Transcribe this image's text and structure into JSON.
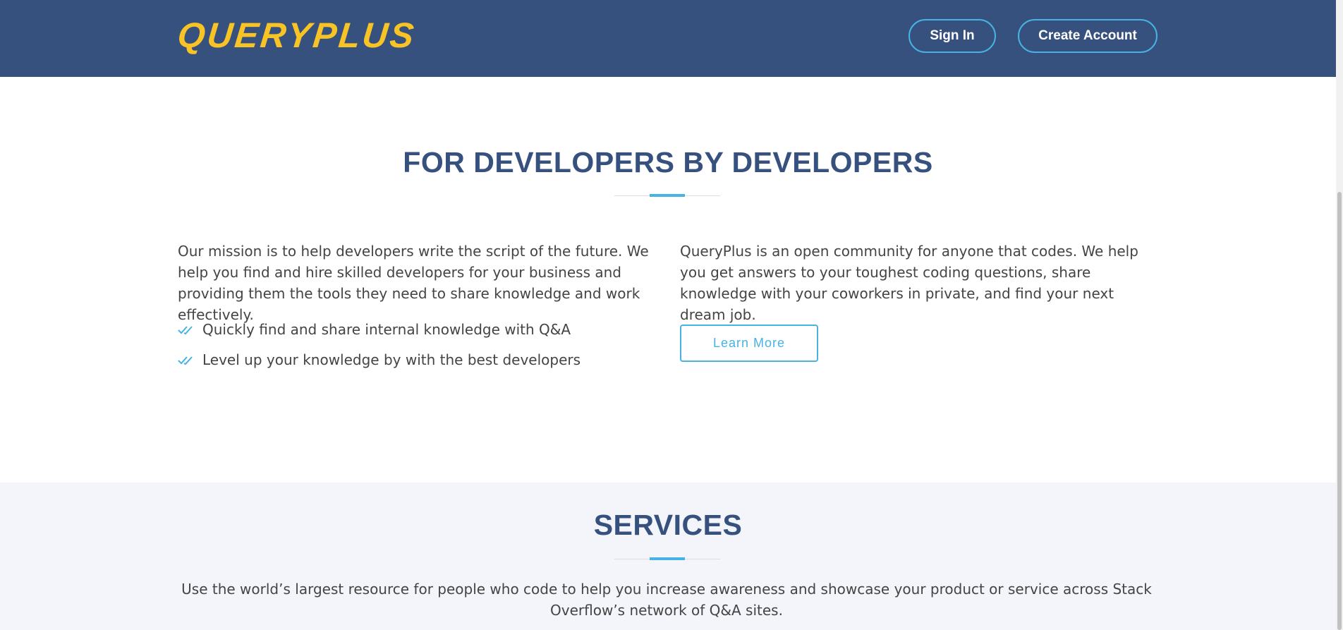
{
  "header": {
    "logo_text": "QUERYPLUS",
    "sign_in_label": "Sign In",
    "create_account_label": "Create Account"
  },
  "about": {
    "title": "FOR DEVELOPERS BY DEVELOPERS",
    "left_paragraph": "Our mission is to help developers write the script of the future. We help you find and hire skilled developers for your business and providing them the tools they need to share knowledge and work effectively.",
    "checklist": [
      {
        "icon": "double-check-icon",
        "text": "Quickly find and share internal knowledge with Q&A"
      },
      {
        "icon": "double-check-icon",
        "text": "Level up your knowledge by with the best developers"
      }
    ],
    "right_paragraph": "QueryPlus is an open community for anyone that codes. We help you get answers to your toughest coding questions, share knowledge with your coworkers in private, and find your next dream job.",
    "learn_more_label": "Learn More"
  },
  "services": {
    "title": "SERVICES",
    "description": "Use the world’s largest resource for people who code to help you increase awareness and showcase your product or service across Stack Overflow’s network of Q&A sites."
  },
  "colors": {
    "header_bg": "#37517e",
    "logo": "#f7c325",
    "accent": "#47b2e4",
    "heading": "#37517e",
    "body_text": "#444444",
    "services_bg": "#f3f5fa"
  }
}
